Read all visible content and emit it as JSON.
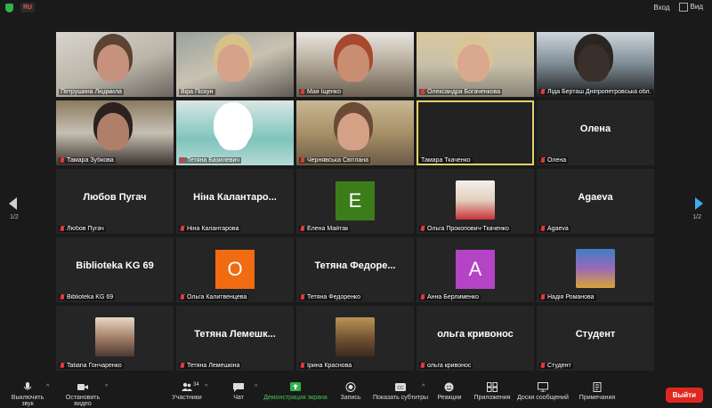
{
  "topbar": {
    "language": "RU",
    "login": "Вход",
    "view": "Вид"
  },
  "pagination": {
    "left": "1/2",
    "right": "1/2"
  },
  "tiles": [
    {
      "name": "Петрушина Людмила",
      "type": "video",
      "muted": false
    },
    {
      "name": "Віра Піскун",
      "type": "video",
      "muted": false
    },
    {
      "name": "Мая Іщенко",
      "type": "video",
      "muted": true
    },
    {
      "name": "Олександра Богаченкова",
      "type": "video",
      "muted": true
    },
    {
      "name": "Ліда Берташ Дніпропетровська обл.",
      "type": "video",
      "muted": true
    },
    {
      "name": "Тамара Зубкова",
      "type": "video",
      "muted": true
    },
    {
      "name": "Тетяна Базилевич",
      "type": "video",
      "muted": true
    },
    {
      "name": "Чернявська Світлана",
      "type": "video",
      "muted": true
    },
    {
      "name": "Тамара Ткаченко",
      "type": "dark",
      "muted": false,
      "active": true
    },
    {
      "name": "Олена",
      "type": "text",
      "big": "Олена",
      "muted": true
    },
    {
      "name": "Любов Пугач",
      "type": "text",
      "big": "Любов Пугач",
      "muted": true
    },
    {
      "name": "Ніна Калантарова",
      "type": "text",
      "big": "Ніна Калантаро...",
      "muted": true
    },
    {
      "name": "Елена Майтак",
      "type": "letter",
      "letter": "E",
      "color": "#3c7d19",
      "muted": true
    },
    {
      "name": "Ольга Прокопович-Ткаченко",
      "type": "photo",
      "muted": true
    },
    {
      "name": "Agaeva",
      "type": "text",
      "big": "Agaeva",
      "muted": true
    },
    {
      "name": "Biblioteka KG 69",
      "type": "text",
      "big": "Biblioteka KG 69",
      "muted": true
    },
    {
      "name": "Ольга Калитвенцева",
      "type": "letter",
      "letter": "O",
      "color": "#f06b11",
      "muted": true
    },
    {
      "name": "Тетяна Федоренко",
      "type": "text",
      "big": "Тетяна Федоре...",
      "muted": true
    },
    {
      "name": "Анна Берлименко",
      "type": "letter",
      "letter": "A",
      "color": "#b443c6",
      "muted": true
    },
    {
      "name": "Надія Романова",
      "type": "photo",
      "muted": true
    },
    {
      "name": "Tatiana Гончаренко",
      "type": "photo",
      "muted": true
    },
    {
      "name": "Тетяна Лемешкіна",
      "type": "text",
      "big": "Тетяна Лемешк...",
      "muted": true
    },
    {
      "name": "Ірина Краснова",
      "type": "photo",
      "muted": true
    },
    {
      "name": "ольга кривонос",
      "type": "text",
      "big": "ольга кривонос",
      "muted": true
    },
    {
      "name": "Студент",
      "type": "text",
      "big": "Студент",
      "muted": true
    }
  ],
  "toolbar": {
    "mute": "Выключить звук",
    "video": "Остановить видео",
    "participants": "Участники",
    "participants_count": "34",
    "chat": "Чат",
    "share": "Демонстрация экрана",
    "record": "Запись",
    "subtitles": "Показать субтитры",
    "reactions": "Реакции",
    "apps": "Приложения",
    "whiteboards": "Доски сообщений",
    "notes": "Примечания",
    "leave": "Выйти"
  }
}
